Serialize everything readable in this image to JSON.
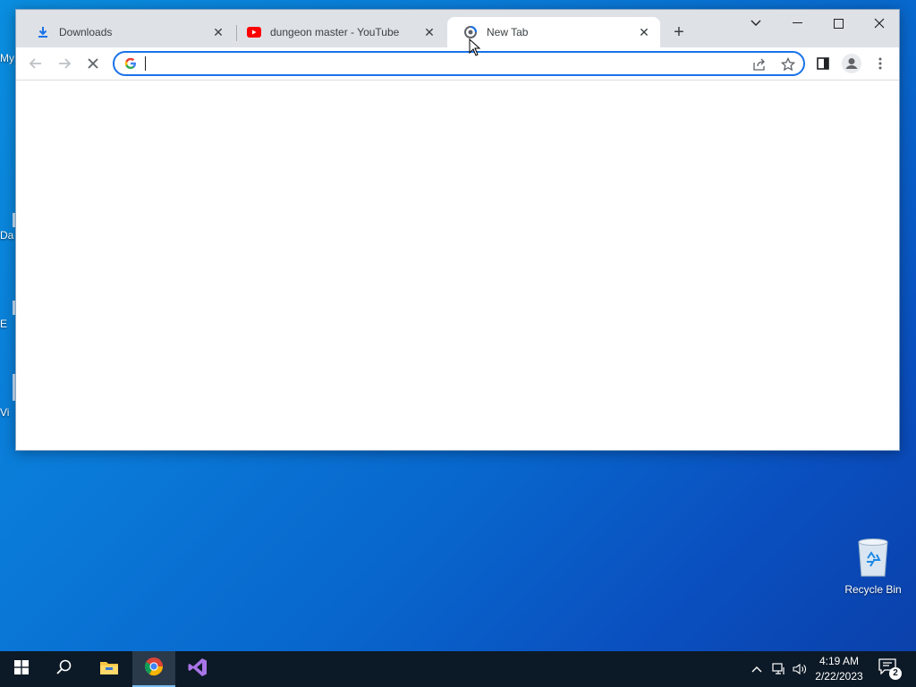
{
  "desktop": {
    "left_icons": [
      {
        "label": "My"
      },
      {
        "label": "Da"
      },
      {
        "label": "E"
      },
      {
        "label": "Vi"
      }
    ],
    "recycle_bin": {
      "label": "Recycle Bin",
      "icon": "recycle-bin-icon"
    }
  },
  "browser": {
    "tabs": [
      {
        "title": "Downloads",
        "icon": "download-icon",
        "active": false
      },
      {
        "title": "dungeon master - YouTube",
        "icon": "youtube-icon",
        "active": false
      },
      {
        "title": "New Tab",
        "icon": "chrome-loading-icon",
        "active": true
      }
    ],
    "new_tab_label": "+",
    "window_controls": [
      "tab-search-icon",
      "minimize-icon",
      "maximize-icon",
      "close-icon"
    ],
    "toolbar": {
      "back_icon": "back-arrow-icon",
      "forward_icon": "forward-arrow-icon",
      "stop_icon": "stop-loading-icon",
      "omnibox": {
        "value": "",
        "placeholder": "",
        "search_engine_icon": "google-icon"
      },
      "omnibox_actions": [
        "share-icon",
        "bookmark-star-icon"
      ],
      "right_actions": [
        "side-panel-icon",
        "profile-avatar-icon",
        "more-menu-icon"
      ]
    }
  },
  "taskbar": {
    "items": [
      {
        "name": "start-button",
        "icon": "windows-icon"
      },
      {
        "name": "search-button",
        "icon": "search-icon"
      },
      {
        "name": "file-explorer",
        "icon": "folder-icon"
      },
      {
        "name": "chrome",
        "icon": "chrome-icon",
        "active": true
      },
      {
        "name": "visual-studio",
        "icon": "visual-studio-icon"
      }
    ],
    "tray": {
      "icons": [
        "chevron-up-icon",
        "network-icon",
        "volume-icon"
      ],
      "time": "4:19 AM",
      "date": "2/22/2023",
      "notification_count": "2"
    }
  },
  "colors": {
    "accent": "#1a73e8",
    "tabstrip": "#dee1e6",
    "taskbar": "#0c1926",
    "youtube_red": "#ff0000"
  }
}
